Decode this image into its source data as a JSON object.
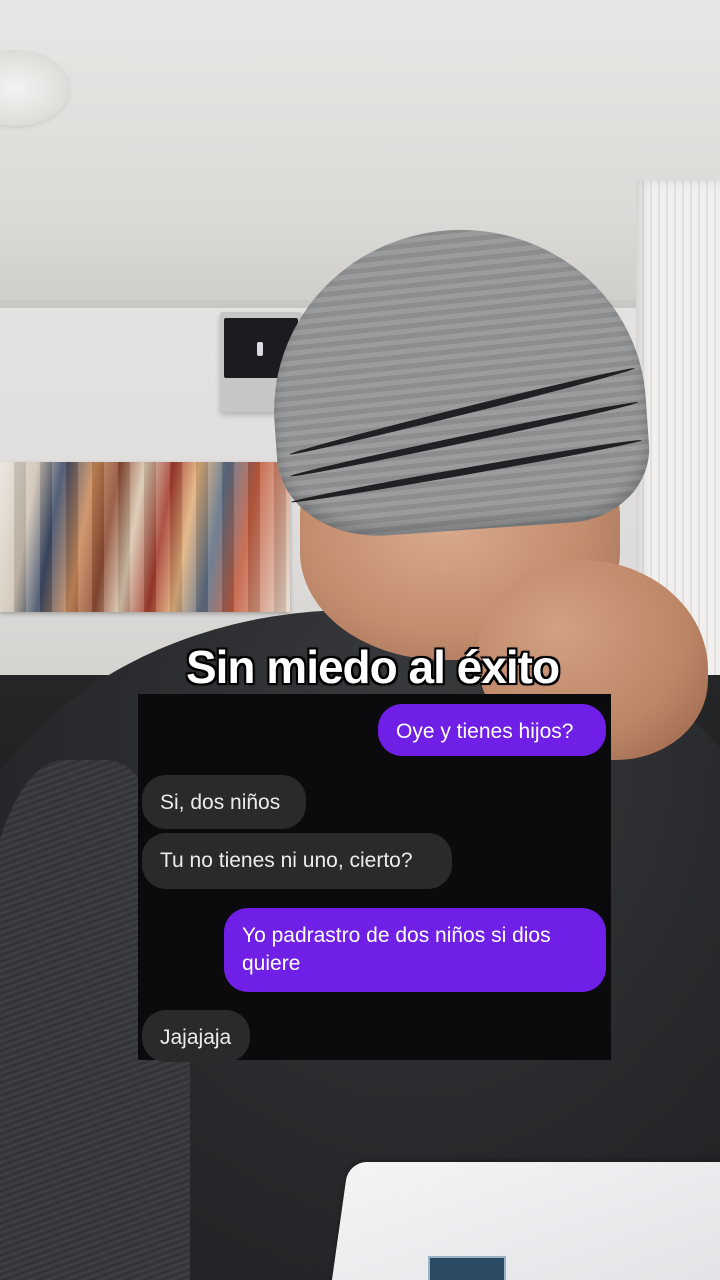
{
  "caption": {
    "text": "Sin miedo al éxito"
  },
  "chat": {
    "messages": [
      {
        "direction": "outgoing",
        "text": "Oye y tienes hijos?"
      },
      {
        "direction": "incoming",
        "text": "Si, dos niños"
      },
      {
        "direction": "incoming",
        "text": "Tu no tienes ni uno, cierto?"
      },
      {
        "direction": "outgoing",
        "text": "Yo padrastro de dos niños si dios quiere"
      },
      {
        "direction": "incoming",
        "text": "Jajajaja"
      }
    ],
    "colors": {
      "outgoing_bubble": "#6f1fe6",
      "incoming_bubble": "#2a2a2d",
      "panel_background": "#0b0b0d"
    }
  },
  "scene": {
    "subjects": [
      "person-in-gray-beanie",
      "abstract-city-painting",
      "air-conditioner",
      "window-blind",
      "laptop"
    ]
  }
}
